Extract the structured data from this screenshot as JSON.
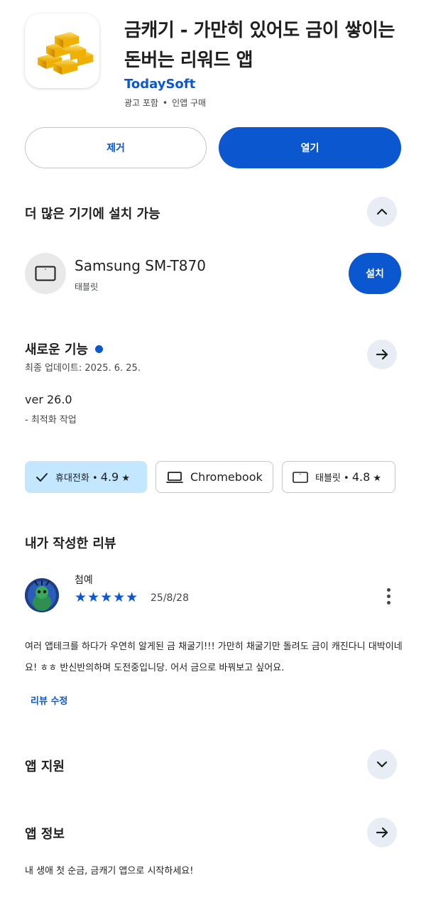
{
  "app": {
    "title": "금캐기 - 가만히 있어도 금이 쌓이는 돈버는 리워드 앱",
    "developer": "TodaySoft",
    "meta": [
      "광고 포함",
      "인앱 구매"
    ],
    "icon": "gold-bars-icon"
  },
  "actions": {
    "uninstall_label": "제거",
    "open_label": "열기"
  },
  "devices_section": {
    "title": "더 많은 기기에 설치 가능",
    "device": {
      "name": "Samsung SM-T870",
      "type": "태블릿",
      "install_label": "설치"
    }
  },
  "whats_new": {
    "title": "새로운 기능",
    "updated": "최종 업데이트: 2025. 6. 25.",
    "version": "ver 26.0",
    "changes": "- 최적화 작업"
  },
  "rating_chips": [
    {
      "label": "휴대전화",
      "rating": "4.9",
      "selected": true,
      "icon": "check-icon"
    },
    {
      "label": "Chromebook",
      "rating": "",
      "selected": false,
      "icon": "laptop-icon"
    },
    {
      "label": "태블릿",
      "rating": "4.8",
      "selected": false,
      "icon": "tablet-icon"
    }
  ],
  "my_review": {
    "title": "내가 작성한 리뷰",
    "reviewer": "첨예",
    "stars": "★★★★★",
    "rating": 5,
    "date": "25/8/28",
    "text": "여러 앱테크를 하다가 우연히 알게된 금 채굴기!!! 가만히 채굴기만 돌려도 금이 캐진다니 대박이네요! ㅎㅎ 반신반의하며 도전중입니당. 어서 금으로 바꿔보고 싶어요.",
    "edit_label": "리뷰 수정"
  },
  "app_support": {
    "title": "앱 지원"
  },
  "app_info": {
    "title": "앱 정보",
    "description": "내 생애 첫 순금, 금캐기 앱으로 시작하세요!"
  },
  "colors": {
    "accent": "#0b57d0",
    "chip_selected": "#c2e7ff",
    "circle_button": "#e8ecf5"
  }
}
